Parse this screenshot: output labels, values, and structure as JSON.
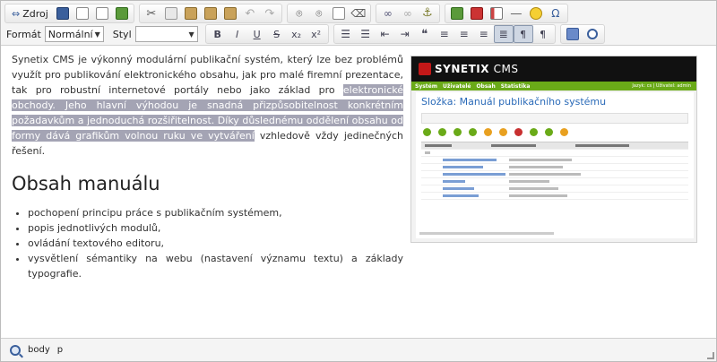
{
  "toolbar": {
    "source_label": "Zdroj",
    "format_label": "Formát",
    "format_value": "Normální",
    "style_label": "Styl",
    "style_value": "",
    "bold": "B",
    "italic": "I",
    "underline": "U",
    "strike": "S",
    "subscript": "x₂",
    "superscript": "x²",
    "quote": "❝",
    "ltr": "¶",
    "rtl": "¶",
    "special_char": "Ω"
  },
  "content": {
    "para_before": "Synetix CMS je výkonný modulární publikační systém, který lze bez problémů využít pro publikování elektronického obsahu, jak pro malé firemní prezentace, tak pro robustní internetové portály nebo jako základ pro ",
    "para_selected": "elektronické obchody. Jeho hlavní výhodou je snadná přizpůsobitelnost konkrétním požadavkům a jednoduchá rozšiřitelnost. Díky důslednému oddělení obsahu od formy dává grafikům volnou ruku ve vytváření",
    "para_after": " vzhledově vždy jedinečných řešení.",
    "heading": "Obsah manuálu",
    "bullets": [
      "pochopení principu práce s publikačním systémem,",
      "popis jednotlivých modulů,",
      "ovládání textového editoru,",
      "vysvětlení sémantiky na webu (nastavení významu textu) a základy typografie."
    ]
  },
  "screenshot": {
    "brand": "SYNETIX",
    "brand_suffix": "CMS",
    "nav": [
      "Systém",
      "Uživatelé",
      "Obsah",
      "Statistika"
    ],
    "user_text": "Jazyk: cs | Uživatel: admin",
    "title": "Složka: Manuál publikačního systému"
  },
  "statusbar": {
    "items": [
      "body",
      "p"
    ]
  },
  "colors": {
    "selection": "#a4a4b4",
    "accent_green": "#6aaa18",
    "link_blue": "#2a6ab8"
  }
}
